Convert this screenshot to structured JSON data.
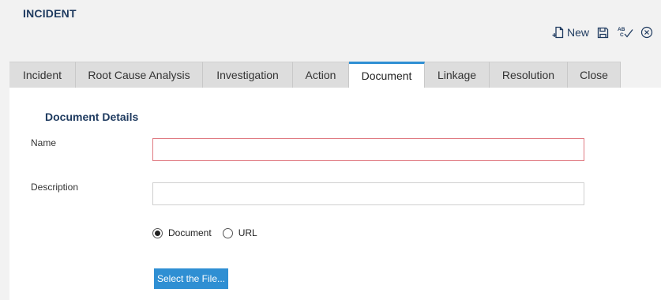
{
  "page": {
    "title": "INCIDENT"
  },
  "toolbar": {
    "new_label": "New",
    "icons": [
      "new-document-icon",
      "save-icon",
      "spellcheck-icon",
      "close-circle-icon"
    ]
  },
  "tabs": [
    {
      "label": "Incident",
      "active": false
    },
    {
      "label": "Root Cause Analysis",
      "active": false
    },
    {
      "label": "Investigation",
      "active": false
    },
    {
      "label": "Action",
      "active": false
    },
    {
      "label": "Document",
      "active": true
    },
    {
      "label": "Linkage",
      "active": false
    },
    {
      "label": "Resolution",
      "active": false
    },
    {
      "label": "Close",
      "active": false
    }
  ],
  "form": {
    "section_title": "Document Details",
    "name_label": "Name",
    "name_value": "",
    "description_label": "Description",
    "description_value": "",
    "type_options": [
      {
        "label": "Document",
        "selected": true
      },
      {
        "label": "URL",
        "selected": false
      }
    ],
    "select_file_label": "Select the File..."
  },
  "colors": {
    "accent": "#2f8fd3",
    "title": "#1e3a5f",
    "invalid_border": "#e07a82"
  }
}
